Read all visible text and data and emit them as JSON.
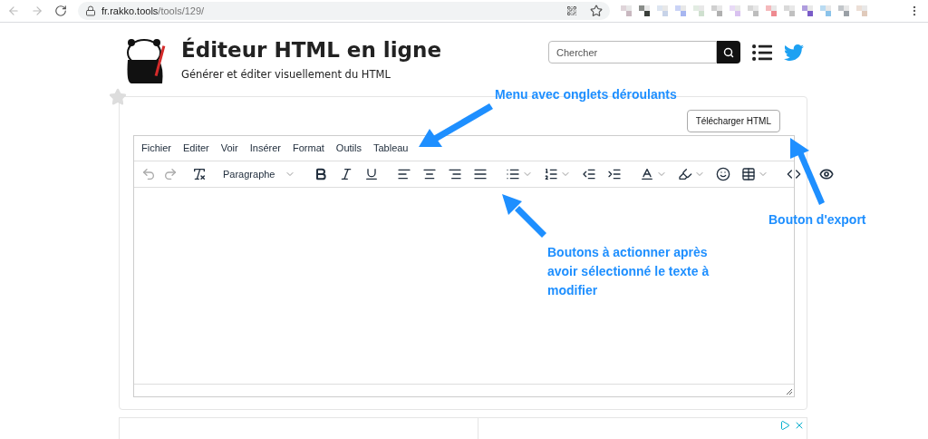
{
  "browser": {
    "url_host": "fr.rakko.tools",
    "url_path": "/tools/129/"
  },
  "header": {
    "title": "Éditeur HTML en ligne",
    "subtitle": "Générer et éditer visuellement du HTML",
    "search": {
      "placeholder": "Chercher"
    }
  },
  "download_button": "Télécharger HTML",
  "editor": {
    "menu": [
      "Fichier",
      "Editer",
      "Voir",
      "Insérer",
      "Format",
      "Outils",
      "Tableau"
    ],
    "block_format": "Paragraphe"
  },
  "annotations": [
    {
      "text": "Menu avec onglets déroulants"
    },
    {
      "text": "Bouton d'export"
    },
    {
      "text": "Boutons à actionner après avoir sélectionné le texte à modifier"
    }
  ]
}
